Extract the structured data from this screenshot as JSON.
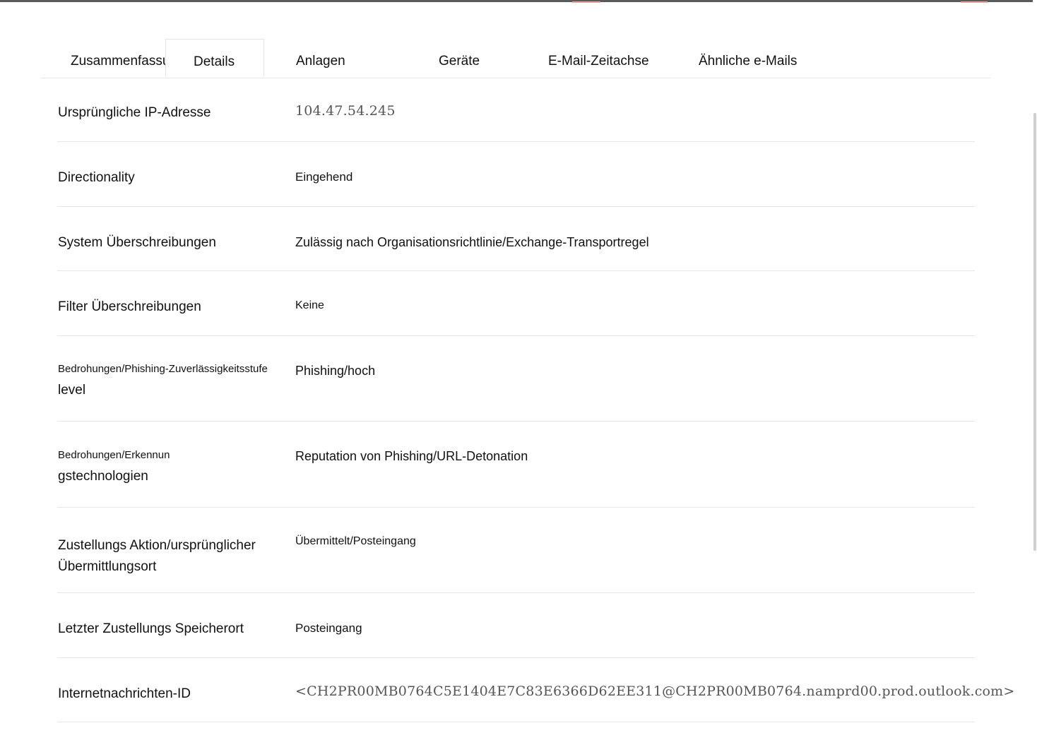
{
  "tabs": [
    {
      "label": "Zusammenfassung",
      "active": false
    },
    {
      "label": "Details",
      "active": true
    },
    {
      "label": "Anlagen",
      "active": false
    },
    {
      "label": "Geräte",
      "active": false
    },
    {
      "label": "E-Mail-Zeitachse",
      "active": false
    },
    {
      "label": "Ähnliche e-Mails",
      "active": false
    }
  ],
  "details": [
    {
      "label": "Ursprüngliche IP-Adresse",
      "value": "104.47.54.245"
    },
    {
      "label": "Directionality",
      "value": "Eingehend"
    },
    {
      "label": "System Überschreibungen",
      "value": "Zulässig nach Organisationsrichtlinie/Exchange-Transportregel"
    },
    {
      "label": "Filter Überschreibungen",
      "value": "Keine"
    },
    {
      "label_line1": "Bedrohungen/Phishing-Zuverlässigkeitsstufe",
      "label_line2": "level",
      "value": "Phishing/hoch"
    },
    {
      "label_line1": "Bedrohungen/Erkennun",
      "label_line2": "gstechnologien",
      "value": "Reputation von Phishing/URL-Detonation"
    },
    {
      "label_line1": "Zustellungs Aktion/ursprünglicher",
      "label_line2": "Übermittlungsort",
      "value": "Übermittelt/Posteingang"
    },
    {
      "label": "Letzter Zustellungs Speicherort",
      "value": "Posteingang"
    },
    {
      "label": "Internetnachrichten-ID",
      "value": "<CH2PR00MB0764C5E1404E7C83E6366D62EE311@CH2PR00MB0764.namprd00.prod.outlook.com>"
    }
  ]
}
